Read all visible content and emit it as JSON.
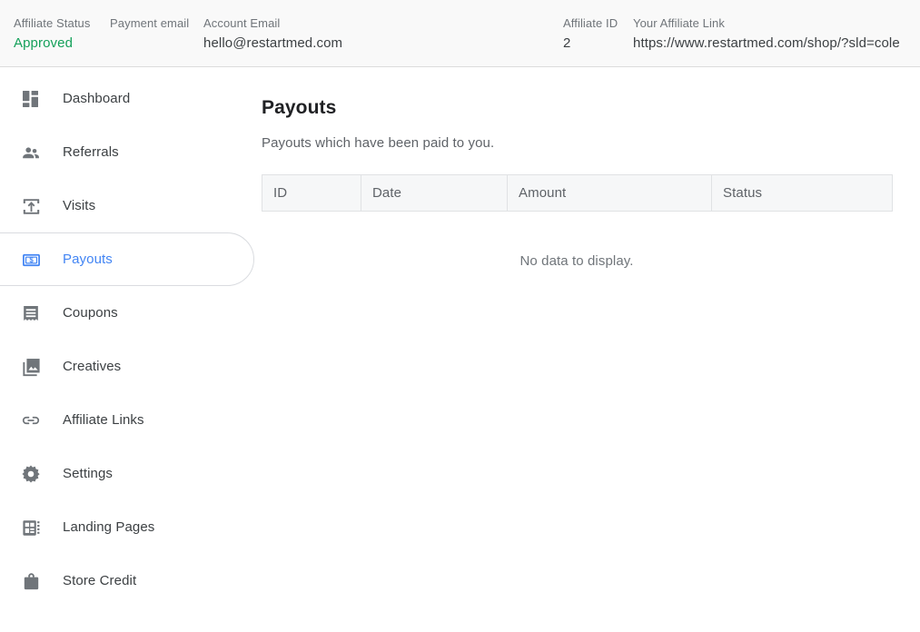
{
  "header": {
    "fields": [
      {
        "label": "Affiliate Status",
        "value": "Approved",
        "name": "affiliate-status"
      },
      {
        "label": "Payment email",
        "value": "",
        "name": "payment-email"
      },
      {
        "label": "Account Email",
        "value": "hello@restartmed.com",
        "name": "account-email"
      },
      {
        "label": "Affiliate ID",
        "value": "2",
        "name": "affiliate-id"
      },
      {
        "label": "Your Affiliate Link",
        "value": "https://www.restartmed.com/shop/?sld=cole",
        "name": "affiliate-link"
      }
    ],
    "status_color": "#14a05a"
  },
  "sidebar": {
    "active_color": "#4285f4",
    "items": [
      {
        "label": "Dashboard",
        "icon": "dashboard-icon",
        "active": false
      },
      {
        "label": "Referrals",
        "icon": "people-icon",
        "active": false
      },
      {
        "label": "Visits",
        "icon": "exit-to-app-icon",
        "active": false
      },
      {
        "label": "Payouts",
        "icon": "money-icon",
        "active": true
      },
      {
        "label": "Coupons",
        "icon": "receipt-icon",
        "active": false
      },
      {
        "label": "Creatives",
        "icon": "photo-library-icon",
        "active": false
      },
      {
        "label": "Affiliate Links",
        "icon": "link-icon",
        "active": false
      },
      {
        "label": "Settings",
        "icon": "gear-icon",
        "active": false
      },
      {
        "label": "Landing Pages",
        "icon": "page-layout-icon",
        "active": false
      },
      {
        "label": "Store Credit",
        "icon": "shopping-bag-icon",
        "active": false
      }
    ]
  },
  "main": {
    "title": "Payouts",
    "subtitle": "Payouts which have been paid to you.",
    "table": {
      "columns": [
        "ID",
        "Date",
        "Amount",
        "Status"
      ],
      "rows": []
    },
    "empty_message": "No data to display."
  }
}
